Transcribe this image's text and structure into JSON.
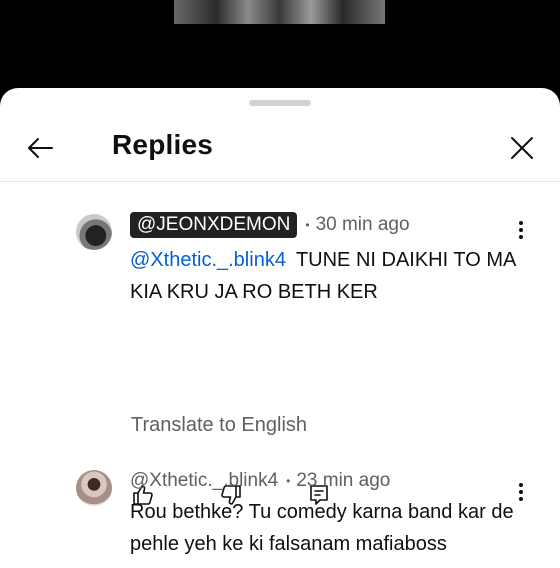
{
  "header": {
    "title": "Replies"
  },
  "comments": [
    {
      "author": "@JEONXDEMON",
      "time": "30 min ago",
      "mention": "@Xthetic._.blink4",
      "body": "TUNE NI DAIKHI TO MA KIA KRU JA RO BETH KER",
      "translate_label": "Translate to English"
    },
    {
      "author": "@Xthetic._.blink4",
      "time": "23 min ago",
      "body": "Rou bethke? Tu comedy karna band kar de pehle yeh ke ki falsanam mafiaboss"
    }
  ],
  "icons": {
    "back": "arrow-left-icon",
    "close": "close-icon",
    "more": "more-vert-icon",
    "like": "thumbs-up-icon",
    "dislike": "thumbs-down-icon",
    "reply": "comment-icon"
  }
}
